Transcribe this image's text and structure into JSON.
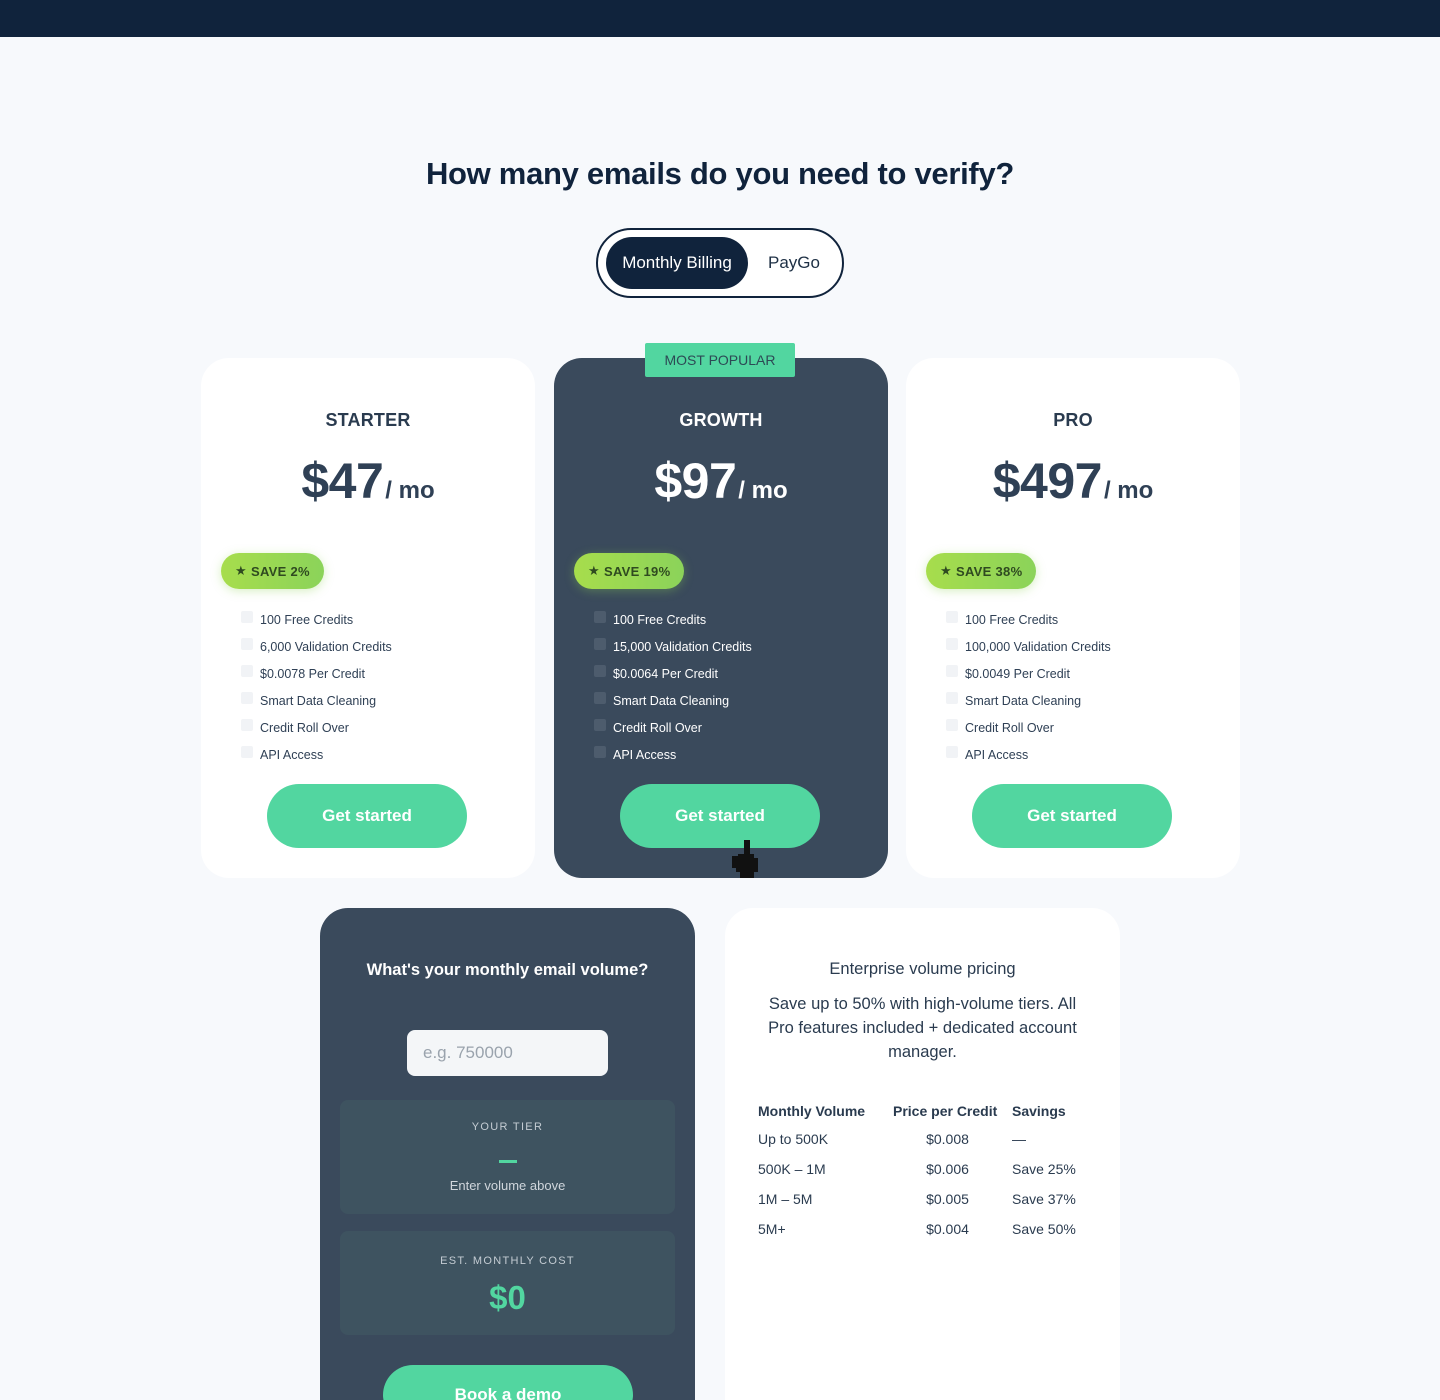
{
  "headline": "How many emails do you need to verify?",
  "billing_toggle": {
    "monthly": "Monthly Billing",
    "paygo": "PayGo",
    "selected": "Monthly Billing"
  },
  "popular_badge": "MOST POPULAR",
  "plans": [
    {
      "name": "STARTER",
      "amount": "$47",
      "period": "/ mo",
      "save": "SAVE 2%",
      "features": [
        "100 Free Credits",
        "6,000 Validation Credits",
        "$0.0078 Per Credit",
        "Smart Data Cleaning",
        "Credit Roll Over",
        "API Access"
      ],
      "cta": "Get started"
    },
    {
      "name": "GROWTH",
      "amount": "$97",
      "period": "/ mo",
      "save": "SAVE 19%",
      "features": [
        "100 Free Credits",
        "15,000 Validation Credits",
        "$0.0064 Per Credit",
        "Smart Data Cleaning",
        "Credit Roll Over",
        "API Access"
      ],
      "cta": "Get started"
    },
    {
      "name": "PRO",
      "amount": "$497",
      "period": "/ mo",
      "save": "SAVE 38%",
      "features": [
        "100 Free Credits",
        "100,000 Validation Credits",
        "$0.0049 Per Credit",
        "Smart Data Cleaning",
        "Credit Roll Over",
        "API Access"
      ],
      "cta": "Get started"
    }
  ],
  "calculator": {
    "title": "What's your monthly email volume?",
    "input_placeholder": "e.g. 750000",
    "input_value": "",
    "tier_label": "YOUR TIER",
    "tier_value": "—",
    "tier_hint": "Enter volume above",
    "cost_label": "EST. MONTHLY COST",
    "cost_value": "$0",
    "cta": "Book a demo"
  },
  "enterprise": {
    "title": "Enterprise volume pricing",
    "description": "Save up to 50% with high-volume tiers. All Pro features included + dedicated account manager.",
    "columns": [
      "Monthly Volume",
      "Price per Credit",
      "Savings"
    ],
    "rows": [
      [
        "Up to 500K",
        "$0.008",
        "—"
      ],
      [
        "500K – 1M",
        "$0.006",
        "Save 25%"
      ],
      [
        "1M – 5M",
        "$0.005",
        "Save 37%"
      ],
      [
        "5M+",
        "$0.004",
        "Save 50%"
      ]
    ]
  },
  "colors": {
    "navy": "#10233c",
    "card_dark": "#3a4a5c",
    "accent_green": "#52d6a0",
    "badge_lime": "#a7dd4c"
  },
  "icons": {
    "badge": "star-icon",
    "feature": "check-icon",
    "pointer": "hand-cursor-icon"
  }
}
